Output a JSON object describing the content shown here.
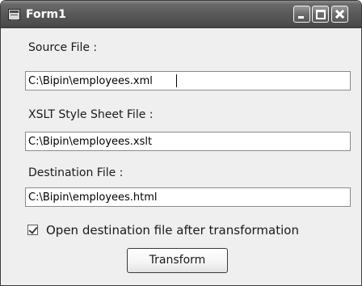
{
  "window": {
    "title": "Form1",
    "icons": {
      "app": "form-window-icon",
      "minimize": "minimize-icon",
      "maximize": "maximize-icon",
      "close": "close-icon"
    }
  },
  "form": {
    "source": {
      "label": "Source File :",
      "value": "C:\\Bipin\\employees.xml"
    },
    "xslt": {
      "label": "XSLT Style Sheet File :",
      "value": "C:\\Bipin\\employees.xslt"
    },
    "destination": {
      "label": "Destination File :",
      "value": "C:\\Bipin\\employees.html"
    },
    "open_after": {
      "label": "Open destination file after transformation",
      "checked": true
    },
    "transform_button": "Transform"
  }
}
